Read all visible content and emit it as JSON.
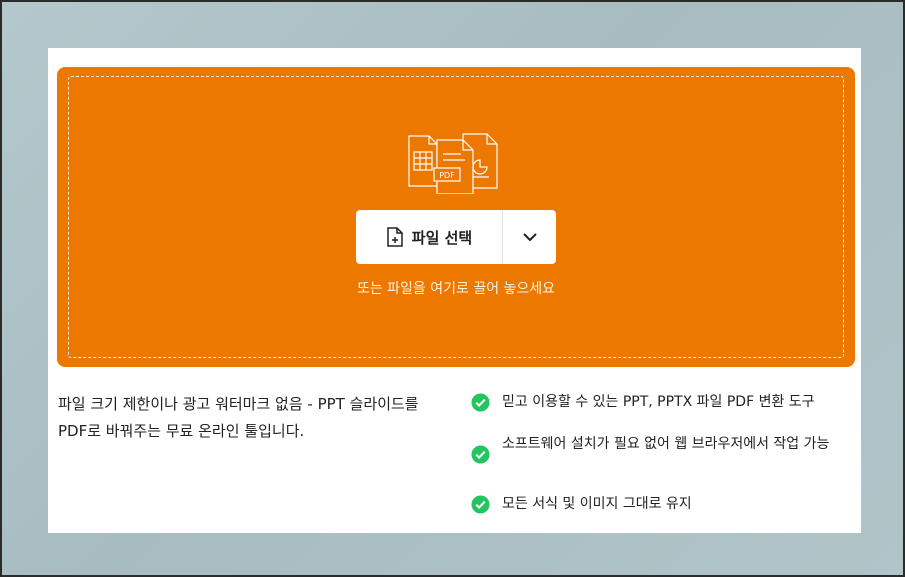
{
  "upload": {
    "select_button_label": "파일 선택",
    "drop_hint": "또는 파일을 여기로 끌어 놓으세요",
    "illustration_badge": "PDF"
  },
  "description": "파일 크기 제한이나 광고 워터마크 없음 - PPT 슬라이드를 PDF로 바꿔주는 무료 온라인 툴입니다.",
  "features": [
    {
      "text": "믿고 이용할 수 있는 PPT, PPTX 파일 PDF 변환 도구"
    },
    {
      "text": "소프트웨어 설치가 필요 없어 웹 브라우저에서 작업 가능"
    },
    {
      "text": "모든 서식 및 이미지 그대로 유지"
    }
  ],
  "colors": {
    "accent": "#ec7800",
    "check": "#22c55e",
    "background": "#a9bec3"
  }
}
